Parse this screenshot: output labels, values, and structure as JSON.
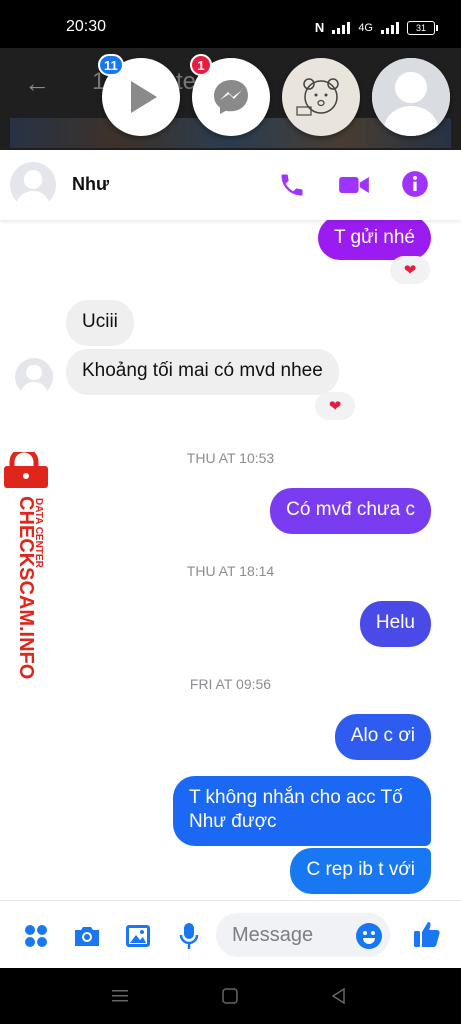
{
  "status_bar": {
    "time": "20:30",
    "network": "4G",
    "battery": "31"
  },
  "background": {
    "title_fragment": "1",
    "title_fragment2": "te"
  },
  "chat_heads": [
    {
      "name": "play-chat-head",
      "badge": "11",
      "badge_color": "#1877f2"
    },
    {
      "name": "messenger-chat-head",
      "badge": "1",
      "badge_color": "#e41e3f"
    },
    {
      "name": "winnie-chat-head"
    },
    {
      "name": "default-avatar-chat-head"
    }
  ],
  "chat": {
    "contact_name": "Như",
    "colors": {
      "purple": "#9b1cf0",
      "violet": "#7a3cf0",
      "indigo": "#4a4ae8",
      "blue": "#1877f2",
      "icon": "#a033ff"
    },
    "messages": [
      {
        "text": "T gửi nhé"
      },
      {
        "reaction": "❤"
      },
      {
        "text": "Uciii"
      },
      {
        "text": "Khoảng tối mai có mvd nhee"
      },
      {
        "reaction": "❤"
      },
      {
        "timestamp": "THU AT 10:53"
      },
      {
        "text": "Có mvđ chưa c"
      },
      {
        "timestamp": "THU AT 18:14"
      },
      {
        "text": "Helu"
      },
      {
        "timestamp": "FRI AT 09:56"
      },
      {
        "text": "Alo c ơi"
      },
      {
        "text": "T không nhắn cho acc Tố Như được"
      },
      {
        "text": "C rep ib t với"
      }
    ]
  },
  "watermark": {
    "brand": "CHECKSCAM.INFO",
    "sub": "DATA CENTER"
  },
  "composer": {
    "placeholder": "Message"
  }
}
